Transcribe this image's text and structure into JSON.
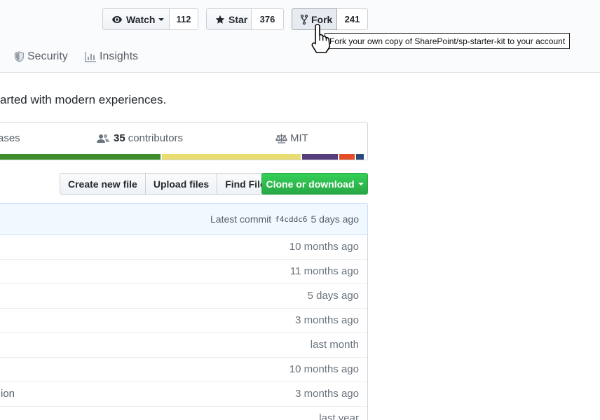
{
  "header": {
    "watch": {
      "label": "Watch",
      "count": "112"
    },
    "star": {
      "label": "Star",
      "count": "376"
    },
    "fork": {
      "label": "Fork",
      "count": "241",
      "tooltip": "Fork your own copy of SharePoint/sp-starter-kit to your account"
    },
    "tabs": [
      {
        "label": "Security",
        "icon": "shield-icon"
      },
      {
        "label": "Insights",
        "icon": "graph-icon"
      }
    ]
  },
  "repo": {
    "description_visible": "arted with modern experiences."
  },
  "stats": {
    "releases_label": "ases",
    "contributors_count": "35",
    "contributors_label": "contributors",
    "license": "MIT"
  },
  "language_bar": [
    {
      "color": "#3f8c2c",
      "share": 0.44
    },
    {
      "color": "#e9dc70",
      "share": 0.38
    },
    {
      "color": "#563d7c",
      "share": 0.1
    },
    {
      "color": "#e34c26",
      "share": 0.045
    },
    {
      "color": "#2b4a7a",
      "share": 0.025
    }
  ],
  "actions": {
    "create_file": "Create new file",
    "upload_files": "Upload files",
    "find_file": "Find File",
    "clone": "Clone or download"
  },
  "commit": {
    "prefix": "Latest commit",
    "sha": "f4cddc6",
    "age": "5 days ago"
  },
  "files": [
    {
      "msg": "",
      "age": "10 months ago"
    },
    {
      "msg": "",
      "age": "11 months ago"
    },
    {
      "msg": "",
      "age": "5 days ago"
    },
    {
      "msg": "",
      "age": "3 months ago"
    },
    {
      "msg": "",
      "age": "last month"
    },
    {
      "msg": "",
      "age": "10 months ago"
    },
    {
      "msg": "ion",
      "age": "3 months ago"
    },
    {
      "msg": "",
      "age": "last year"
    }
  ],
  "colors": {
    "accent_green": "#28a745",
    "link_blue": "#0366d6"
  }
}
